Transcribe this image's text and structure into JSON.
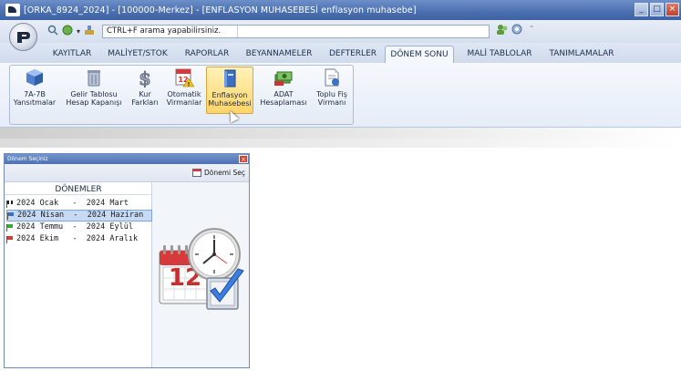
{
  "window": {
    "title": "[ORKA_8924_2024]  -  [100000-Merkez]  -  [ENFLASYON MUHASEBESİ enflasyon muhasebe]",
    "controls": [
      "_",
      "□",
      "×"
    ]
  },
  "quickbar": {
    "search_label": "CTRL+F arama yapabilirsiniz.",
    "search_value": ""
  },
  "tabs": [
    {
      "label": "KAYITLAR",
      "active": false
    },
    {
      "label": "MALİYET/STOK",
      "active": false
    },
    {
      "label": "RAPORLAR",
      "active": false
    },
    {
      "label": "BEYANNAMELER",
      "active": false
    },
    {
      "label": "DEFTERLER",
      "active": false
    },
    {
      "label": "DÖNEM SONU",
      "active": true
    },
    {
      "label": "MALİ TABLOLAR",
      "active": false
    },
    {
      "label": "TANIMLAMALAR",
      "active": false
    }
  ],
  "ribbon": {
    "buttons": [
      {
        "line1": "7A-7B",
        "line2": "Yansıtmalar",
        "icon": "cube-icon"
      },
      {
        "line1": "Gelir Tablosu",
        "line2": "Hesap Kapanışı",
        "icon": "trash-bin-icon"
      },
      {
        "line1": "Kur",
        "line2": "Farkları",
        "icon": "dollar-icon"
      },
      {
        "line1": "Otomatik",
        "line2": "Virmanlar",
        "icon": "calendar-warning-icon"
      },
      {
        "line1": "Enflasyon",
        "line2": "Muhasebesi",
        "icon": "book-icon",
        "active": true
      },
      {
        "line1": "ADAT",
        "line2": "Hesaplaması",
        "icon": "money-icon"
      },
      {
        "line1": "Toplu Fiş",
        "line2": "Virmanı",
        "icon": "document-icon"
      }
    ]
  },
  "dialog": {
    "title": "Dönem Seçiniz",
    "select_button": "Dönemi Seç",
    "list_header": "DÖNEMLER",
    "rows": [
      {
        "start": "2024 Ocak ",
        "end": "2024 Mart",
        "flag": "checker",
        "selected": false
      },
      {
        "start": "2024 Nisan",
        "end": "2024 Haziran",
        "flag": "blue",
        "selected": true
      },
      {
        "start": "2024 Temmu",
        "end": "2024 Eylül",
        "flag": "green",
        "selected": false
      },
      {
        "start": "2024 Ekim ",
        "end": "2024 Aralık",
        "flag": "red",
        "selected": false
      }
    ],
    "illustration": {
      "icon": "calendar-clock-check-icon",
      "calendar_day": "12"
    }
  },
  "colors": {
    "title_bar": "#4a6fb0",
    "active_button": "#ffd56a",
    "selected_row": "#c7daf3"
  }
}
